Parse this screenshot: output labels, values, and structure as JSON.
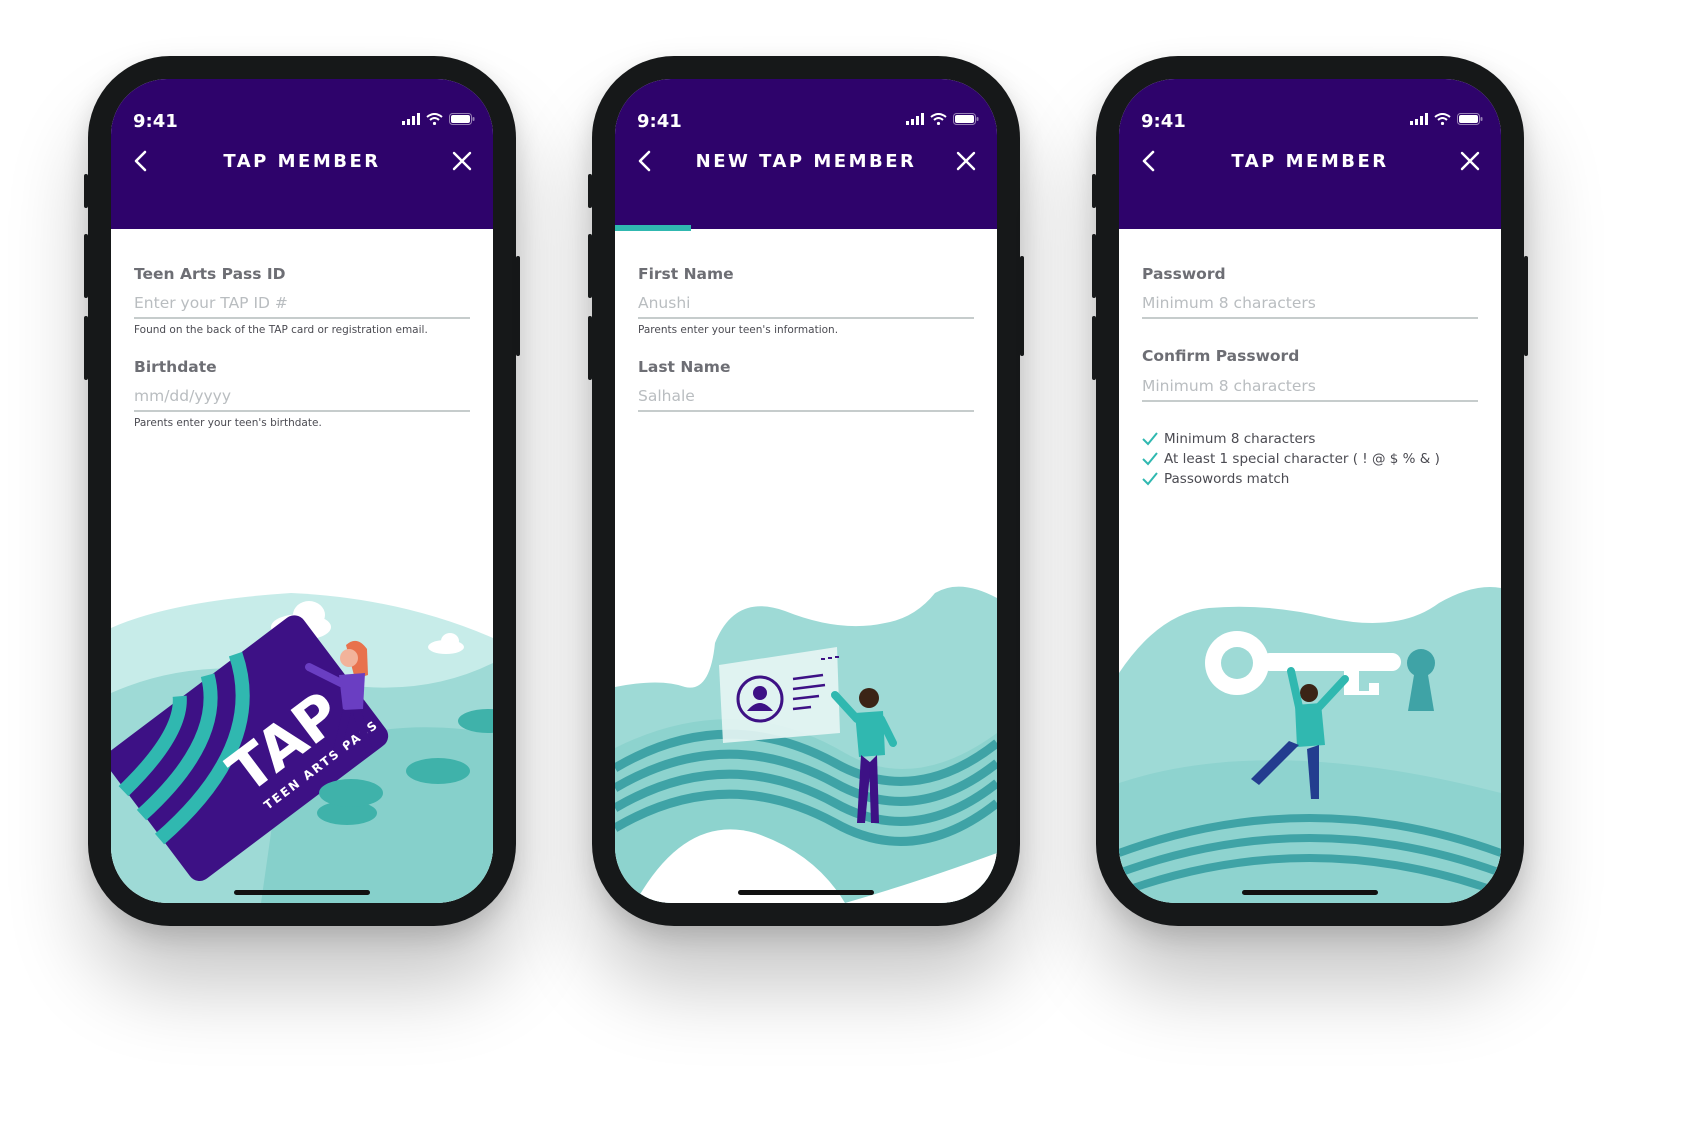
{
  "status": {
    "time": "9:41"
  },
  "colors": {
    "header": "#2e036b",
    "accent": "#30b8b0",
    "teal_light": "#9edad6",
    "purple": "#3d1185"
  },
  "screen1": {
    "title": "TAP MEMBER",
    "fields": [
      {
        "label": "Teen Arts Pass ID",
        "placeholder": "Enter your TAP ID #",
        "help": "Found on the back of the TAP card or registration email."
      },
      {
        "label": "Birthdate",
        "placeholder": "mm/dd/yyyy",
        "help": "Parents enter your teen's birthdate."
      }
    ],
    "card": {
      "logo": "TAP",
      "subtitle": "TEEN ARTS PASS"
    }
  },
  "screen2": {
    "title": "NEW TAP MEMBER",
    "progress": 0.2,
    "fields": [
      {
        "label": "First Name",
        "placeholder": "Anushi",
        "help": "Parents enter your teen's information."
      },
      {
        "label": "Last Name",
        "placeholder": "Salhale"
      }
    ]
  },
  "screen3": {
    "title": "TAP MEMBER",
    "fields": [
      {
        "label": "Password",
        "placeholder": "Minimum 8 characters"
      },
      {
        "label": "Confirm Password",
        "placeholder": "Minimum 8 characters"
      }
    ],
    "checks": [
      "Minimum 8 characters",
      "At least 1 special character ( ! @ $ % & )",
      "Passowords match"
    ]
  },
  "icons": {
    "back": "chevron-left-icon",
    "close": "close-icon",
    "signal": "signal-icon",
    "wifi": "wifi-icon",
    "battery": "battery-icon",
    "check": "check-icon"
  }
}
